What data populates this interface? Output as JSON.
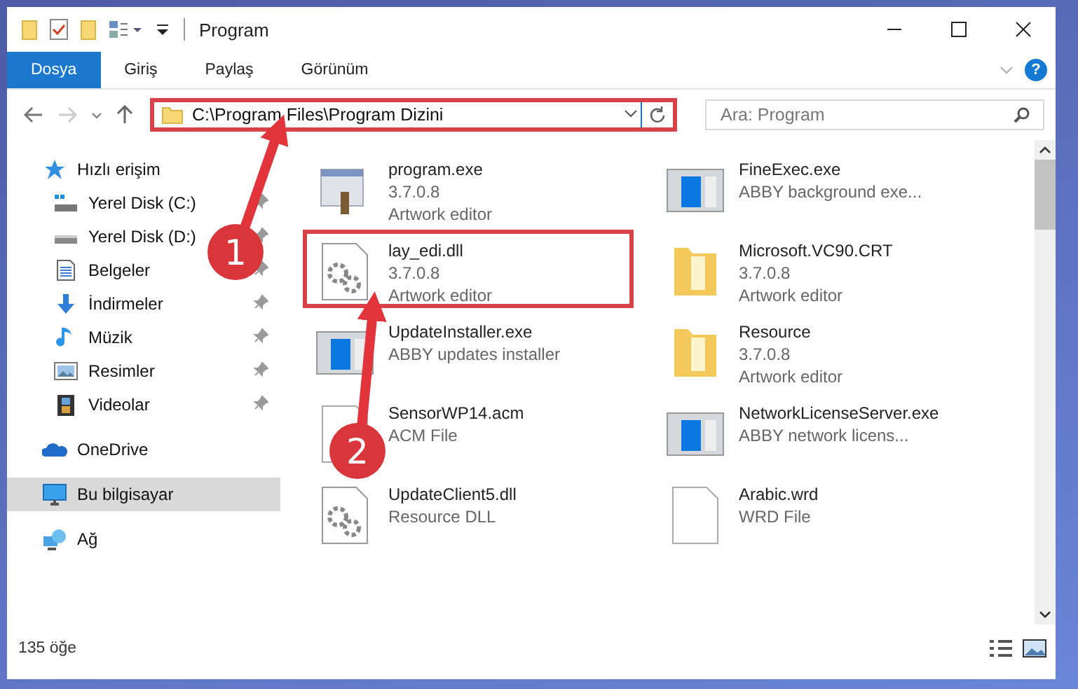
{
  "window": {
    "title": "Program"
  },
  "ribbon": {
    "tabs": [
      {
        "label": "Dosya",
        "selected": true
      },
      {
        "label": "Giriş",
        "selected": false
      },
      {
        "label": "Paylaş",
        "selected": false
      },
      {
        "label": "Görünüm",
        "selected": false
      }
    ],
    "help": "?"
  },
  "address": {
    "path": "C:\\Program Files\\Program Dizini",
    "highlighted": true
  },
  "search": {
    "placeholder": "Ara: Program"
  },
  "sidebar": [
    {
      "label": "Hızlı erişim",
      "kind": "star",
      "selected": false,
      "children": [
        {
          "label": "Yerel Disk (C:)",
          "kind": "drive-win",
          "pinned": true,
          "selected": false
        },
        {
          "label": "Yerel Disk (D:)",
          "kind": "drive",
          "pinned": true,
          "selected": false
        },
        {
          "label": "Belgeler",
          "kind": "docs",
          "pinned": true,
          "selected": false
        },
        {
          "label": "İndirmeler",
          "kind": "download",
          "pinned": true,
          "selected": false
        },
        {
          "label": "Müzik",
          "kind": "music",
          "pinned": true,
          "selected": false
        },
        {
          "label": "Resimler",
          "kind": "pictures",
          "pinned": true,
          "selected": false
        },
        {
          "label": "Videolar",
          "kind": "videos",
          "pinned": true,
          "selected": false
        }
      ]
    },
    {
      "label": "OneDrive",
      "kind": "cloud",
      "selected": false
    },
    {
      "label": "Bu bilgisayar",
      "kind": "computer",
      "selected": true
    },
    {
      "label": "Ağ",
      "kind": "network",
      "selected": false
    }
  ],
  "files": [
    {
      "name": "program.exe",
      "details": [
        "3.7.0.8",
        "Artwork editor"
      ],
      "kind": "app",
      "highlighted": false
    },
    {
      "name": "FineExec.exe",
      "details": [
        "ABBY background exe..."
      ],
      "kind": "window",
      "highlighted": false
    },
    {
      "name": "lay_edi.dll",
      "details": [
        "3.7.0.8",
        "Artwork editor"
      ],
      "kind": "gear-doc",
      "highlighted": true
    },
    {
      "name": "Microsoft.VC90.CRT",
      "details": [
        "3.7.0.8",
        "Artwork editor"
      ],
      "kind": "folder",
      "highlighted": false
    },
    {
      "name": "UpdateInstaller.exe",
      "details": [
        "ABBY updates installer"
      ],
      "kind": "window",
      "highlighted": false
    },
    {
      "name": "Resource",
      "details": [
        "3.7.0.8",
        "Artwork editor"
      ],
      "kind": "folder",
      "highlighted": false
    },
    {
      "name": "SensorWP14.acm",
      "details": [
        "ACM File"
      ],
      "kind": "doc",
      "highlighted": false
    },
    {
      "name": "NetworkLicenseServer.exe",
      "details": [
        "ABBY network licens..."
      ],
      "kind": "window",
      "highlighted": false
    },
    {
      "name": "UpdateClient5.dll",
      "details": [
        "Resource DLL"
      ],
      "kind": "gear-doc",
      "highlighted": false
    },
    {
      "name": "Arabic.wrd",
      "details": [
        "WRD File"
      ],
      "kind": "doc",
      "highlighted": false
    }
  ],
  "status_bar": {
    "item_count": "135 öğe"
  },
  "annotations": [
    {
      "label": "1"
    },
    {
      "label": "2"
    }
  ]
}
